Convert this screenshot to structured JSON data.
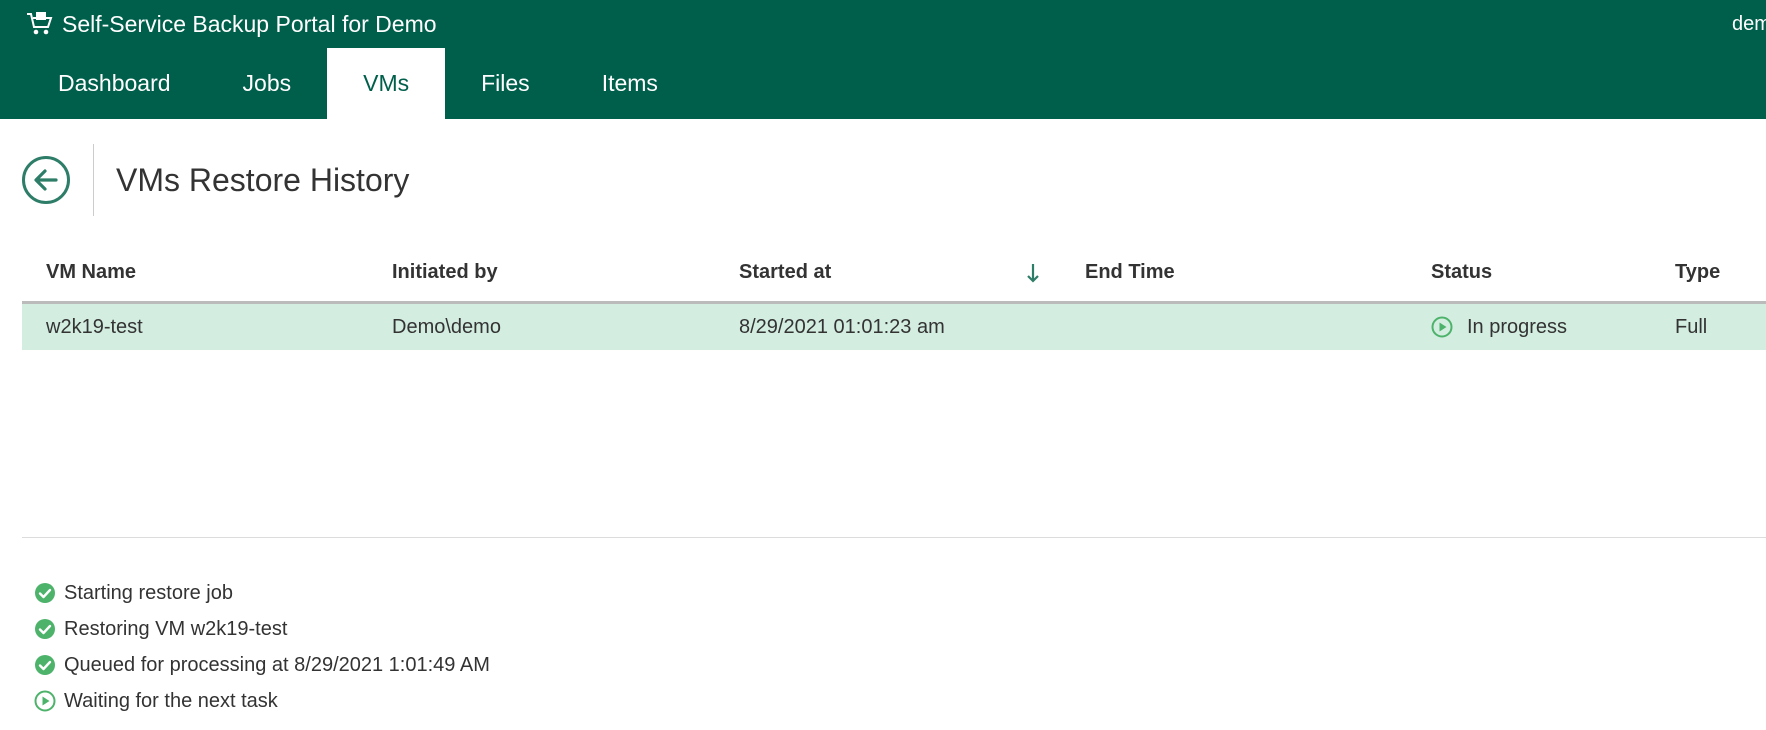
{
  "app": {
    "title": "Self-Service Backup Portal for Demo",
    "user": "demo",
    "brand_icon": "cart-icon"
  },
  "colors": {
    "header_bg": "#005f4b",
    "accent": "#2e7d68",
    "row_selected": "#d3ede1",
    "success": "#4db36b"
  },
  "tabs": [
    {
      "label": "Dashboard",
      "active": false
    },
    {
      "label": "Jobs",
      "active": false
    },
    {
      "label": "VMs",
      "active": true
    },
    {
      "label": "Files",
      "active": false
    },
    {
      "label": "Items",
      "active": false
    }
  ],
  "page": {
    "title": "VMs Restore History",
    "back_icon": "back-arrow-icon"
  },
  "table": {
    "columns": {
      "vm_name": "VM Name",
      "initiated_by": "Initiated by",
      "started_at": "Started at",
      "end_time": "End Time",
      "status": "Status",
      "type": "Type"
    },
    "sort_column": "started_at",
    "sort_direction": "descending",
    "rows": [
      {
        "vm_name": "w2k19-test",
        "initiated_by": "Demo\\demo",
        "started_at": "8/29/2021 01:01:23 am",
        "end_time": "",
        "status": "In progress",
        "status_icon": "play-circle-icon",
        "type": "Full"
      }
    ]
  },
  "log": [
    {
      "text": "Starting restore job",
      "icon": "check-circle-icon"
    },
    {
      "text": "Restoring VM w2k19-test",
      "icon": "check-circle-icon"
    },
    {
      "text": "Queued for processing at 8/29/2021 1:01:49 AM",
      "icon": "check-circle-icon"
    },
    {
      "text": "Waiting for the next task",
      "icon": "play-circle-icon"
    }
  ]
}
